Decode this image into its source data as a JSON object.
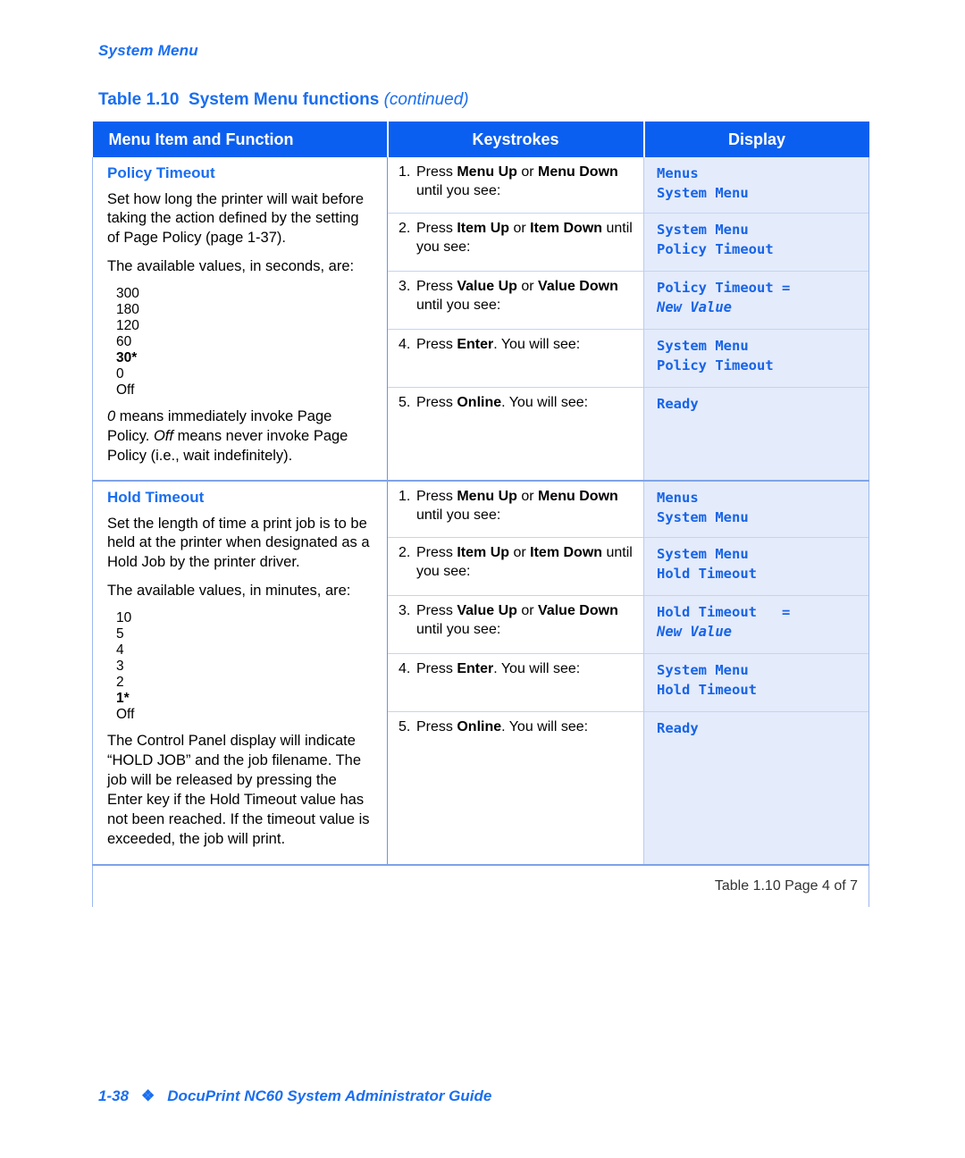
{
  "running_head": "System Menu",
  "caption": {
    "number": "Table 1.10",
    "title": "System Menu functions",
    "continued": "(continued)"
  },
  "colors": {
    "header_bg": "#0b5ff0",
    "accent_blue": "#1a6ef0",
    "display_text": "#1764e8",
    "display_bg": "#e4ebfa"
  },
  "table": {
    "headers": {
      "menu_item": "Menu Item and Function",
      "keystrokes": "Keystrokes",
      "display": "Display"
    },
    "sections": [
      {
        "title": "Policy Timeout",
        "paragraphs": [
          "Set how long the printer will wait before taking the action defined by the setting of Page Policy (page 1-37).",
          "The available values, in seconds, are:"
        ],
        "values": [
          "300",
          "180",
          "120",
          "60",
          "30*",
          "0",
          "Off"
        ],
        "default_value": "30*",
        "note_pre": "0",
        "note": " means immediately invoke Page Policy. ",
        "note_italic2": "Off",
        "note_tail": " means never invoke Page Policy (i.e., wait indefinitely).",
        "steps": [
          {
            "num": "1.",
            "text_parts": [
              "Press ",
              "Menu Up",
              " or ",
              "Menu Down",
              " until you see:"
            ]
          },
          {
            "num": "2.",
            "text_parts": [
              "Press ",
              "Item Up",
              " or ",
              "Item Down",
              " until you see:"
            ]
          },
          {
            "num": "3.",
            "text_parts": [
              "Press ",
              "Value Up",
              " or ",
              "Value Down",
              " until you see:"
            ]
          },
          {
            "num": "4.",
            "text_parts": [
              "Press ",
              "Enter",
              ". You will see:"
            ]
          },
          {
            "num": "5.",
            "text_parts": [
              "Press ",
              "Online",
              ". You will see:"
            ]
          }
        ],
        "displays": [
          {
            "line1": "Menus",
            "line2": "System Menu",
            "line2_italic": false
          },
          {
            "line1": "System Menu",
            "line2": "Policy Timeout",
            "line2_italic": false
          },
          {
            "line1": "Policy Timeout =",
            "line2": "New Value",
            "line2_italic": true
          },
          {
            "line1": "System Menu",
            "line2": "Policy Timeout",
            "line2_italic": false
          },
          {
            "line1": "Ready",
            "line2": "",
            "line2_italic": false
          }
        ]
      },
      {
        "title": "Hold Timeout",
        "paragraphs": [
          "Set the length of time a print job is to be held at the printer when designated as a Hold Job by the printer driver.",
          "The available values, in minutes, are:"
        ],
        "values": [
          "10",
          "5",
          "4",
          "3",
          "2",
          "1*",
          "Off"
        ],
        "default_value": "1*",
        "note_plain": "The Control Panel display will indicate “HOLD JOB” and the job filename. The job will be released by pressing the Enter key if the Hold Timeout value has not been reached. If the timeout value is exceeded, the job will print.",
        "steps": [
          {
            "num": "1.",
            "text_parts": [
              "Press ",
              "Menu Up",
              " or ",
              "Menu Down",
              " until you see:"
            ]
          },
          {
            "num": "2.",
            "text_parts": [
              "Press ",
              "Item Up",
              " or ",
              "Item Down",
              " until you see:"
            ]
          },
          {
            "num": "3.",
            "text_parts": [
              "Press ",
              "Value Up",
              " or ",
              "Value Down",
              " until you see:"
            ]
          },
          {
            "num": "4.",
            "text_parts": [
              "Press ",
              "Enter",
              ". You will see:"
            ]
          },
          {
            "num": "5.",
            "text_parts": [
              "Press ",
              "Online",
              ". You will see:"
            ]
          }
        ],
        "displays": [
          {
            "line1": "Menus",
            "line2": "System Menu",
            "line2_italic": false
          },
          {
            "line1": "System Menu",
            "line2": "Hold Timeout",
            "line2_italic": false
          },
          {
            "line1": "Hold Timeout   =",
            "line2": "New Value",
            "line2_italic": true
          },
          {
            "line1": "System Menu",
            "line2": "Hold Timeout",
            "line2_italic": false
          },
          {
            "line1": "Ready",
            "line2": "",
            "line2_italic": false
          }
        ]
      }
    ],
    "footer_note": "Table 1.10  Page 4 of 7"
  },
  "page_footer": {
    "page_number": "1-38",
    "diamond": "❖",
    "guide_title": "DocuPrint NC60 System Administrator Guide"
  }
}
